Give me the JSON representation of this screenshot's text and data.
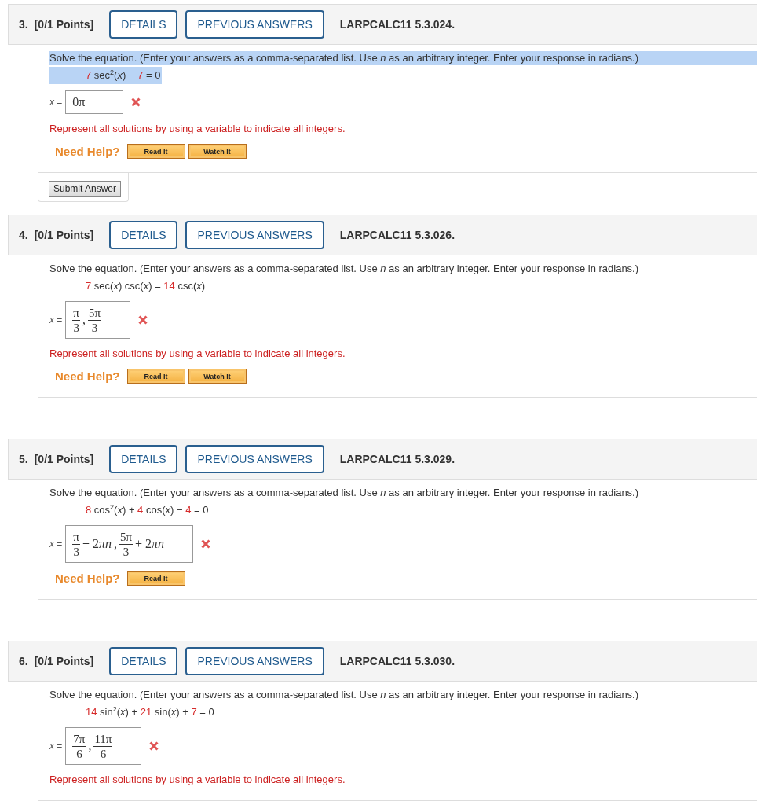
{
  "questions": [
    {
      "number": "3.",
      "points": "[0/1 Points]",
      "details": "DETAILS",
      "previous_answers": "PREVIOUS ANSWERS",
      "code": "LARPCALC11 5.3.024.",
      "text_selected": true,
      "instructions": "Solve the equation. (Enter your answers as a comma-separated list. Use *n* as an arbitrary integer. Enter your response in radians.)",
      "equation": [
        {
          "kind": "number",
          "text": "7"
        },
        {
          "kind": "plain",
          "text": " sec$^{2}$(*x*) − "
        },
        {
          "kind": "number",
          "text": "7"
        },
        {
          "kind": "plain",
          "text": " = 0"
        }
      ],
      "answer_label": "*x* =",
      "answer": [
        {
          "kind": "text",
          "text": "0π"
        }
      ],
      "correct": false,
      "feedback": "Represent all solutions by using a variable to indicate all integers.",
      "help_label": "Need Help?",
      "help_buttons": [
        "Read It",
        "Watch It"
      ],
      "submit": "Submit Answer"
    },
    {
      "number": "4.",
      "points": "[0/1 Points]",
      "details": "DETAILS",
      "previous_answers": "PREVIOUS ANSWERS",
      "code": "LARPCALC11 5.3.026.",
      "text_selected": false,
      "instructions": "Solve the equation. (Enter your answers as a comma-separated list. Use *n* as an arbitrary integer. Enter your response in radians.)",
      "equation": [
        {
          "kind": "number",
          "text": "7"
        },
        {
          "kind": "plain",
          "text": " sec(*x*) csc(*x*) = "
        },
        {
          "kind": "number",
          "text": "14"
        },
        {
          "kind": "plain",
          "text": " csc(*x*)"
        }
      ],
      "answer_label": "*x* =",
      "answer": [
        {
          "kind": "fraction",
          "numerator": "π",
          "denominator": "3"
        },
        {
          "kind": "text",
          "text": ","
        },
        {
          "kind": "fraction",
          "numerator": "5π",
          "denominator": "3"
        }
      ],
      "correct": false,
      "feedback": "Represent all solutions by using a variable to indicate all integers.",
      "help_label": "Need Help?",
      "help_buttons": [
        "Read It",
        "Watch It"
      ]
    },
    {
      "number": "5.",
      "points": "[0/1 Points]",
      "details": "DETAILS",
      "previous_answers": "PREVIOUS ANSWERS",
      "code": "LARPCALC11 5.3.029.",
      "text_selected": false,
      "instructions": "Solve the equation. (Enter your answers as a comma-separated list. Use *n* as an arbitrary integer. Enter your response in radians.)",
      "equation": [
        {
          "kind": "number",
          "text": "8"
        },
        {
          "kind": "plain",
          "text": " cos$^{2}$(*x*) + "
        },
        {
          "kind": "number",
          "text": "4"
        },
        {
          "kind": "plain",
          "text": " cos(*x*) − "
        },
        {
          "kind": "number",
          "text": "4"
        },
        {
          "kind": "plain",
          "text": " = 0"
        }
      ],
      "answer_label": "*x* =",
      "answer": [
        {
          "kind": "fraction",
          "numerator": "π",
          "denominator": "3"
        },
        {
          "kind": "text",
          "text": "+ 2"
        },
        {
          "kind": "variable",
          "text": "πn"
        },
        {
          "kind": "text",
          "text": ","
        },
        {
          "kind": "fraction",
          "numerator": "5π",
          "denominator": "3"
        },
        {
          "kind": "text",
          "text": "+ 2"
        },
        {
          "kind": "variable",
          "text": "πn"
        }
      ],
      "correct": false,
      "help_label": "Need Help?",
      "help_buttons": [
        "Read It"
      ]
    },
    {
      "number": "6.",
      "points": "[0/1 Points]",
      "details": "DETAILS",
      "previous_answers": "PREVIOUS ANSWERS",
      "code": "LARPCALC11 5.3.030.",
      "text_selected": false,
      "instructions": "Solve the equation. (Enter your answers as a comma-separated list. Use *n* as an arbitrary integer. Enter your response in radians.)",
      "equation": [
        {
          "kind": "number",
          "text": "14"
        },
        {
          "kind": "plain",
          "text": " sin$^{2}$(*x*) + "
        },
        {
          "kind": "number",
          "text": "21"
        },
        {
          "kind": "plain",
          "text": " sin(*x*) + "
        },
        {
          "kind": "number",
          "text": "7"
        },
        {
          "kind": "plain",
          "text": " = 0"
        }
      ],
      "answer_label": "*x* =",
      "answer": [
        {
          "kind": "fraction",
          "numerator": "7π",
          "denominator": "6"
        },
        {
          "kind": "text",
          "text": ","
        },
        {
          "kind": "fraction",
          "numerator": "11π",
          "denominator": "6"
        }
      ],
      "correct": false,
      "feedback": "Represent all solutions by using a variable to indicate all integers."
    }
  ]
}
